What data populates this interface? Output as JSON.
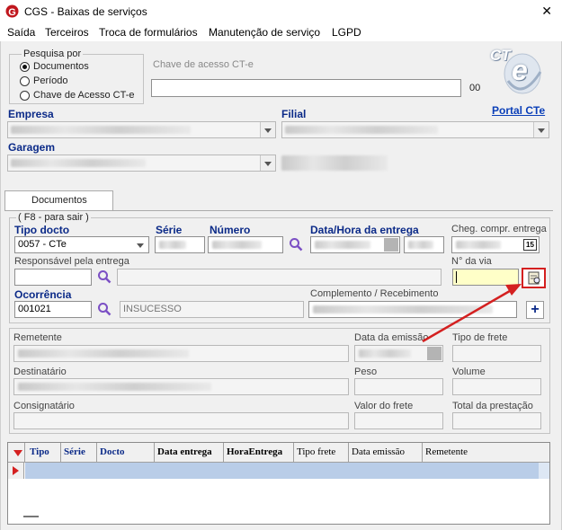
{
  "window": {
    "title": "CGS - Baixas de serviços",
    "close_glyph": "✕"
  },
  "menu": [
    "Saída",
    "Terceiros",
    "Troca de formulários",
    "Manutenção de serviço",
    "LGPD"
  ],
  "search": {
    "group_label": "Pesquisa por",
    "options": [
      "Documentos",
      "Período",
      "Chave de Acesso CT-e"
    ],
    "selected": "Documentos",
    "key_label": "Chave de acesso CT-e",
    "key_value": "",
    "key_suffix": "00"
  },
  "logo": {
    "text": "CT",
    "sub": "e"
  },
  "portal_link": "Portal CTe",
  "labels": {
    "empresa": "Empresa",
    "filial": "Filial",
    "garagem": "Garagem"
  },
  "tab_documentos": "Documentos",
  "section": {
    "group_label": "( F8 - para sair )",
    "tipo_docto_label": "Tipo docto",
    "tipo_docto_value": "0057 - CTe",
    "serie_label": "Série",
    "numero_label": "Número",
    "data_hora_label": "Data/Hora da entrega",
    "cheg_label": "Cheg. compr. entrega",
    "cheg_btn": "15",
    "resp_label": "Responsável pela entrega",
    "via_label": "N° da via",
    "ocorrencia_label": "Ocorrência",
    "ocorrencia_value": "001021",
    "ocorrencia_desc": "INSUCESSO",
    "complemento_label": "Complemento / Recebimento",
    "plus_glyph": "+"
  },
  "info": {
    "remetente": "Remetente",
    "data_emissao": "Data da emissão",
    "tipo_frete": "Tipo de frete",
    "destinatario": "Destinatário",
    "peso": "Peso",
    "volume": "Volume",
    "consignatario": "Consignatário",
    "valor_frete": "Valor do frete",
    "total_prestacao": "Total da prestação"
  },
  "grid": {
    "columns": [
      "Tipo",
      "Série",
      "Docto",
      "Data entrega",
      "HoraEntrega",
      "Tipo frete",
      "Data emissão",
      "Remetente"
    ]
  },
  "colors": {
    "accent_blue": "#0b2a88",
    "highlight_red": "#d42020",
    "selected_row": "#b9cde8"
  }
}
